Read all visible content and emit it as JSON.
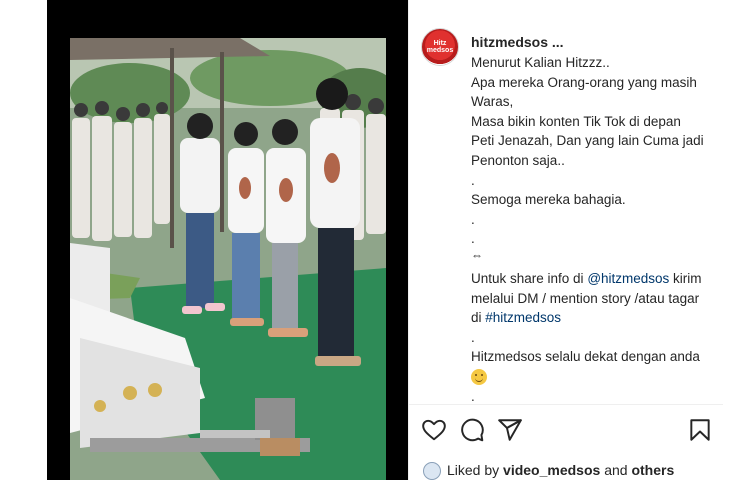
{
  "post": {
    "username": "hitzmedsos ...",
    "avatar_text": "Hitz\nmedsos",
    "caption": {
      "lines": [
        "Menurut Kalian Hitzzz..",
        "Apa mereka Orang-orang yang masih",
        "Waras,",
        "Masa bikin konten Tik Tok di depan",
        "Peti Jenazah, Dan yang lain Cuma jadi",
        "Penonton saja..",
        ".",
        "Semoga mereka bahagia.",
        ".",
        "."
      ],
      "arrows_symbol": "⇔",
      "share_line_1_pre": "Untuk share info di ",
      "share_mention": "@hitzmedsos",
      "share_line_1_post": " kirim",
      "share_line_2": "melalui DM / mention story /atau tagar",
      "share_line_3_pre": "di ",
      "share_hashtag": "#hitzmedsos",
      "dot_a": ".",
      "closing": "Hitzmedsos selalu dekat dengan anda",
      "dot_b": "."
    },
    "likes": {
      "prefix": "Liked by ",
      "user": "video_medsos",
      "middle": " and ",
      "others": "others"
    },
    "icons": [
      "heart-icon",
      "comment-icon",
      "share-icon",
      "bookmark-icon"
    ]
  },
  "colors": {
    "link": "#00376b",
    "media_bg": "#000000",
    "grass": "#2e8b57"
  }
}
